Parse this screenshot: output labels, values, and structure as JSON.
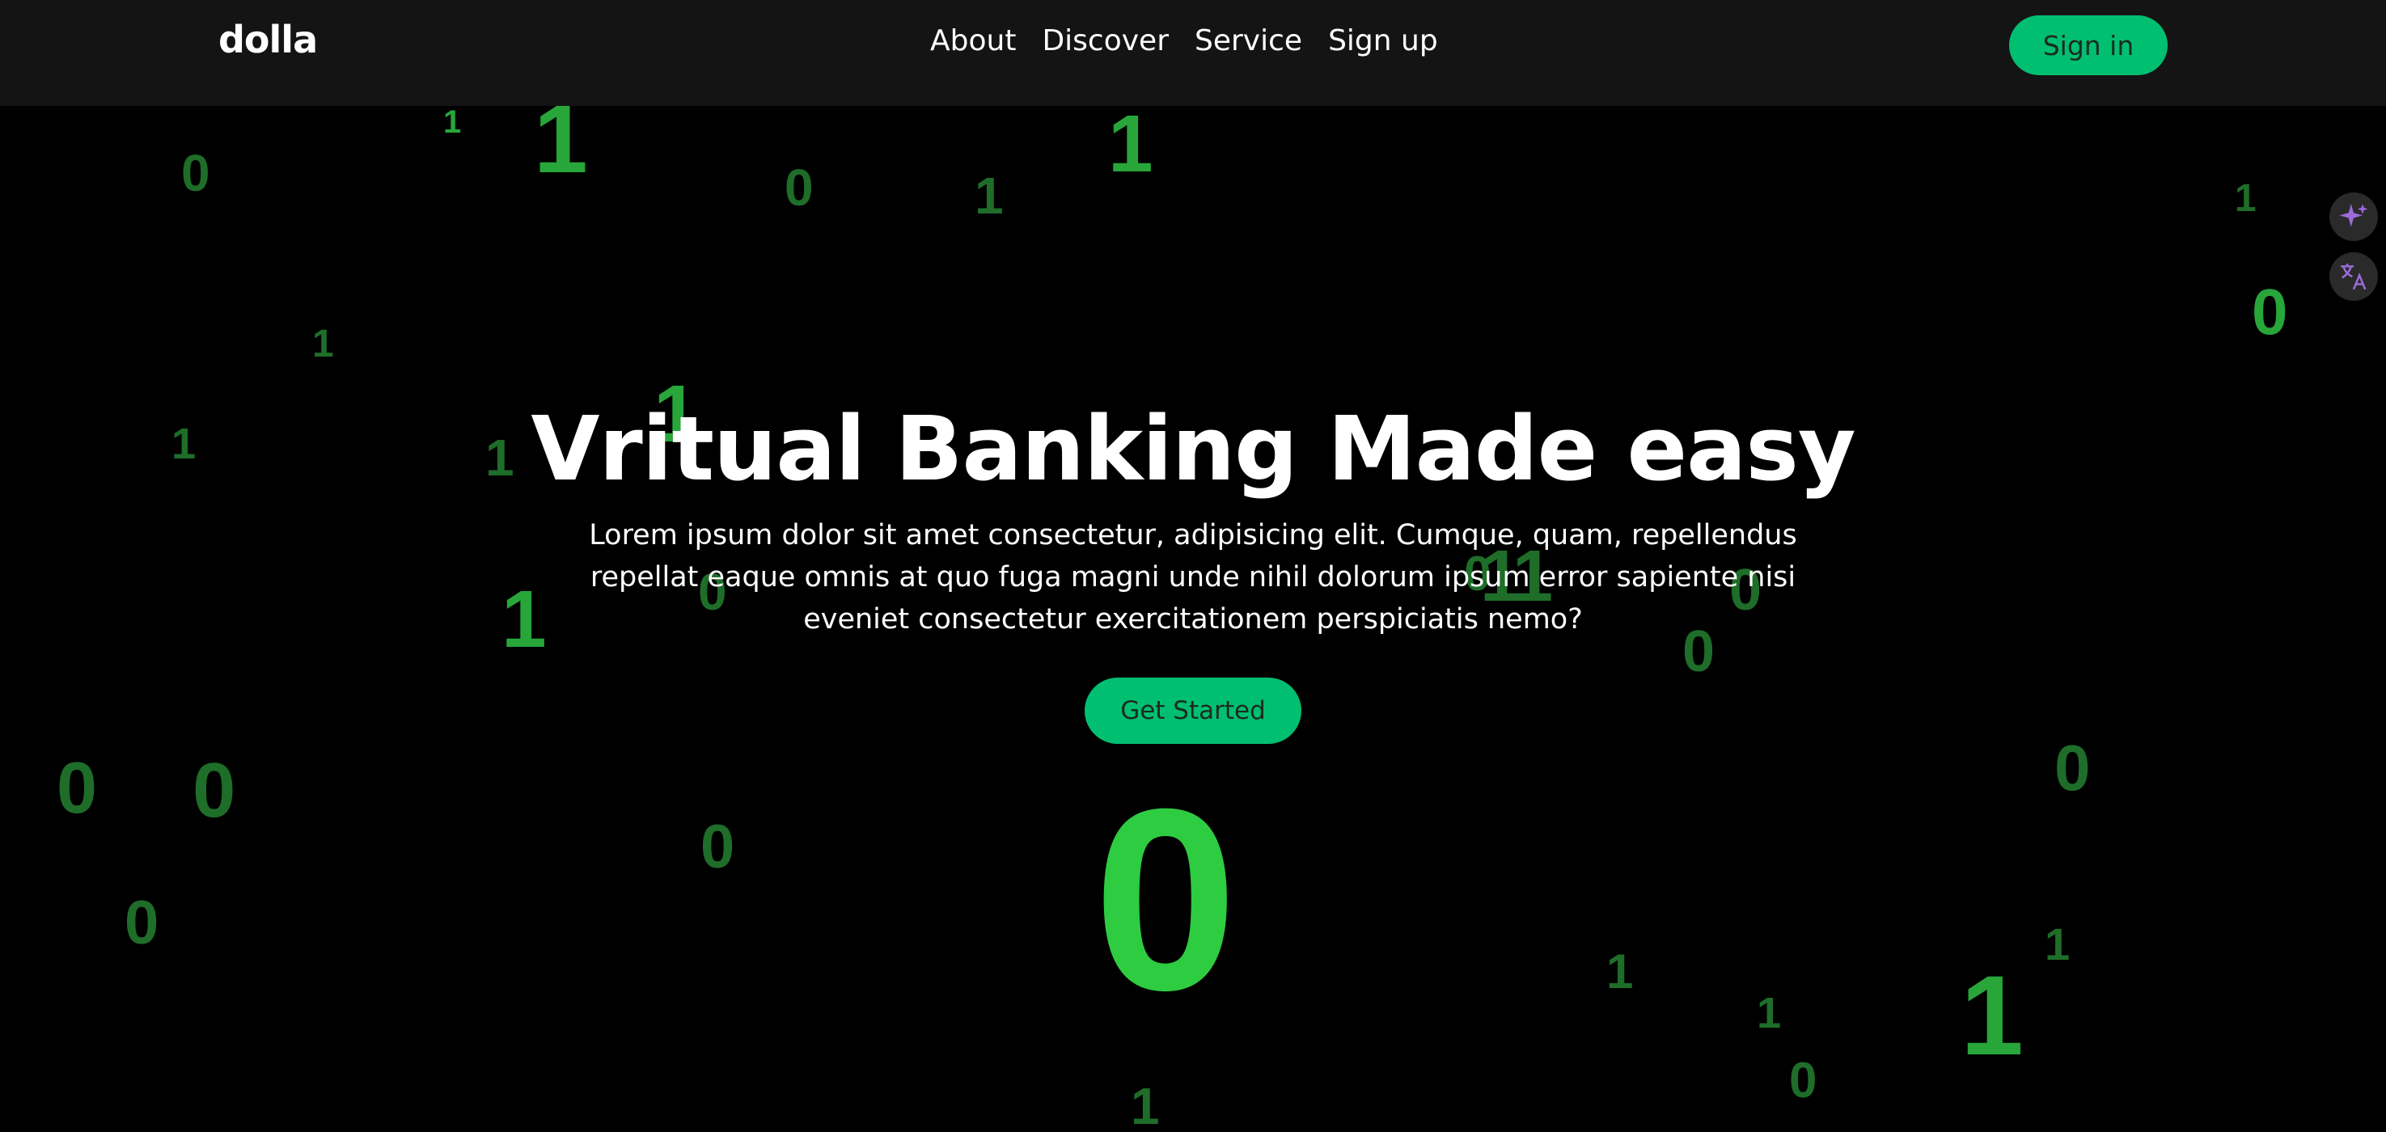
{
  "brand": {
    "logo_text": "dolla",
    "accent_color": "#01bf71"
  },
  "nav": {
    "items": [
      {
        "label": "About"
      },
      {
        "label": "Discover"
      },
      {
        "label": "Service"
      },
      {
        "label": "Sign up"
      }
    ],
    "signin_label": "Sign in"
  },
  "hero": {
    "title": "Vritual Banking Made easy",
    "description": "Lorem ipsum dolor sit amet consectetur, adipisicing elit. Cumque, quam, repellendus repellat eaque omnis at quo fuga magni unde nihil dolorum ipsum error sapiente nisi eveniet consectetur exercitationem perspiciatis nemo?",
    "cta_label": "Get Started"
  },
  "background": {
    "digit_color_dim": "#1e6d29",
    "digit_color_mid": "#28a63a",
    "digit_color_bright": "#2ecc40",
    "digits": [
      "1",
      "1",
      "0",
      "0",
      "1",
      "1",
      "1",
      "1",
      "1",
      "1",
      "0",
      "1",
      "0",
      "1",
      "1",
      "0",
      "0",
      "0",
      "0",
      "0",
      "0",
      "0",
      "0",
      "1",
      "1",
      "1",
      "1",
      "1",
      "0",
      "1",
      "0"
    ]
  },
  "side_widgets": {
    "sparkle_icon": "sparkle-icon",
    "translate_icon": "translate-icon"
  }
}
